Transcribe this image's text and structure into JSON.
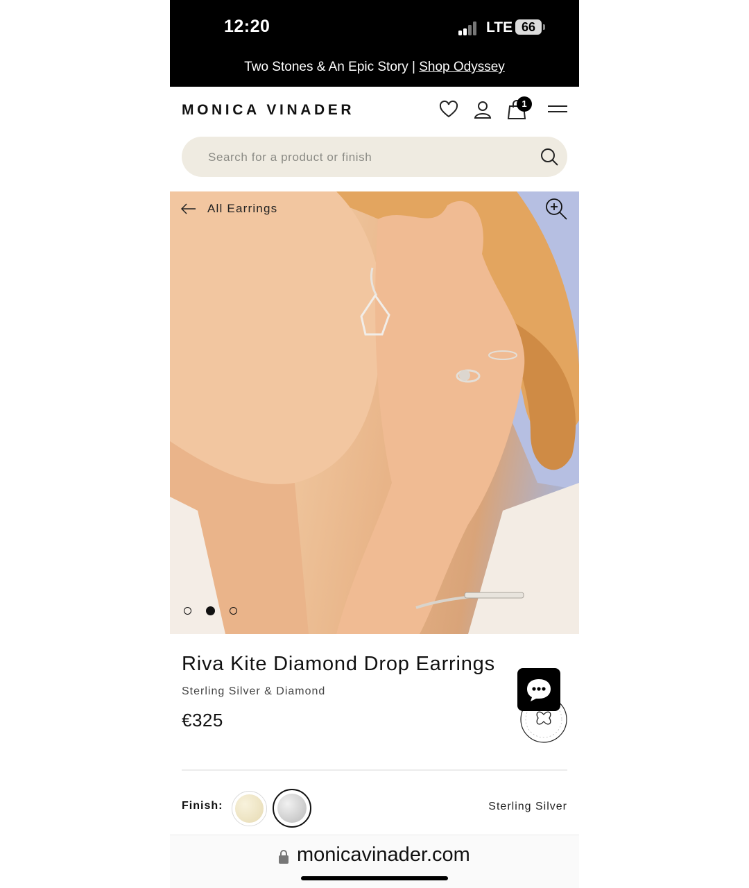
{
  "status_bar": {
    "time": "12:20",
    "network": "LTE",
    "battery": "66"
  },
  "promo": {
    "text": "Two Stones & An Epic Story | ",
    "link": "Shop Odyssey"
  },
  "header": {
    "brand": "MONICA VINADER",
    "cart_count": "1"
  },
  "search": {
    "placeholder": "Search for a product or finish"
  },
  "gallery": {
    "back_label": "All Earrings",
    "slide_count": 3,
    "active_slide": 2
  },
  "product": {
    "title": "Riva Kite Diamond Drop Earrings",
    "subtitle": "Sterling Silver & Diamond",
    "price": "€325"
  },
  "finish": {
    "label": "Finish:",
    "selected": "Sterling Silver",
    "options": [
      {
        "name": "gold",
        "color": "#efe6c6"
      },
      {
        "name": "sterling-silver",
        "color": "#c9c9c9"
      }
    ]
  },
  "browser": {
    "url": "monicavinader.com"
  },
  "colors": {
    "promo_bg": "#000000",
    "search_bg": "#efebe1",
    "accent": "#111111"
  }
}
